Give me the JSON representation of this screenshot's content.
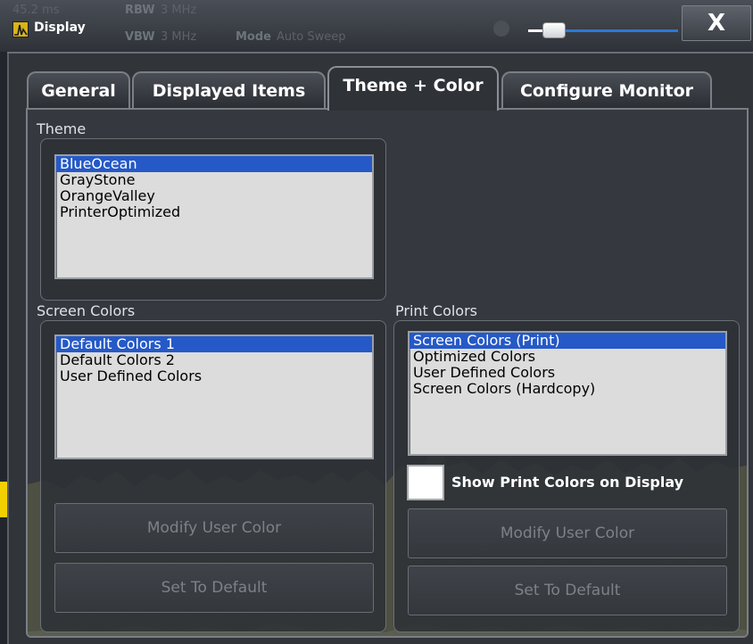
{
  "window": {
    "title": "Display",
    "ghost": {
      "rbw_label": "RBW",
      "rbw_value": "3 MHz",
      "vbw_label": "VBW",
      "vbw_value": "3 MHz",
      "mode_label": "Mode",
      "mode_value": "Auto Sweep",
      "left_value": "45.2 ms"
    },
    "close_label": "X",
    "icons": {
      "app": "spectrum-app-icon",
      "close": "close-icon",
      "zoom": "zoom-slider"
    }
  },
  "tabs": [
    {
      "label": "General",
      "active": false
    },
    {
      "label": "Displayed Items",
      "active": false
    },
    {
      "label": "Theme + Color",
      "active": true
    },
    {
      "label": "Configure Monitor",
      "active": false
    }
  ],
  "theme": {
    "label": "Theme",
    "items": [
      "BlueOcean",
      "GrayStone",
      "OrangeValley",
      "PrinterOptimized"
    ],
    "selected": "BlueOcean"
  },
  "screen_colors": {
    "label": "Screen Colors",
    "items": [
      "Default Colors 1",
      "Default Colors 2",
      "User Defined Colors"
    ],
    "selected": "Default Colors 1",
    "modify_button": "Modify User Color",
    "default_button": "Set To Default"
  },
  "print_colors": {
    "label": "Print Colors",
    "items": [
      "Screen Colors (Print)",
      "Optimized Colors",
      "User Defined Colors",
      "Screen Colors (Hardcopy)"
    ],
    "selected": "Screen Colors (Print)",
    "checkbox_label": "Show Print Colors on Display",
    "checkbox_checked": false,
    "modify_button": "Modify User Color",
    "default_button": "Set To Default"
  },
  "colors": {
    "selection": "#2559c7",
    "accent": "#2b79d6",
    "trace": "#f2d000"
  }
}
